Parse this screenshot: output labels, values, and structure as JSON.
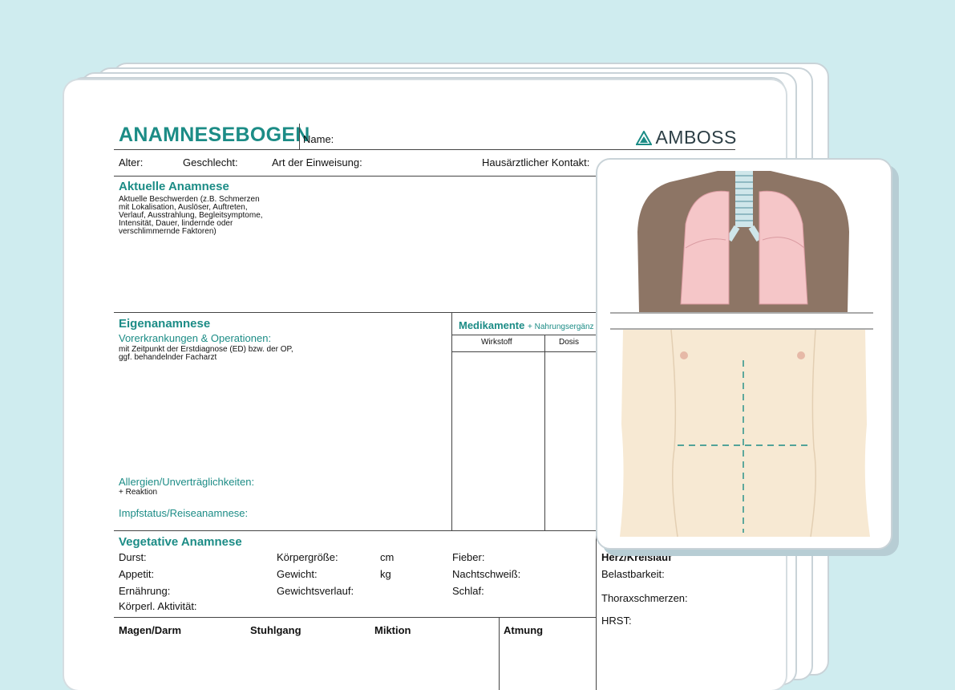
{
  "form": {
    "title": "ANAMNESEBOGEN",
    "name_label": "Name:",
    "logo_text": "AMBOSS",
    "row1": {
      "alter": "Alter:",
      "geschlecht": "Geschlecht:",
      "einweisung": "Art der Einweisung:",
      "hausarzt": "Hausärztlicher Kontakt:"
    },
    "aktuelle": {
      "heading": "Aktuelle Anamnese",
      "lines": [
        "Aktuelle Beschwerden (z.B. Schmerzen",
        "mit Lokalisation, Auslöser, Auftreten,",
        "Verlauf, Ausstrahlung, Begleitsymptome,",
        "Intensität, Dauer, lindernde oder",
        "verschlimmernde Faktoren)"
      ]
    },
    "eigen": {
      "heading": "Eigenanamnese",
      "subheading": "Vorerkrankungen & Operationen:",
      "lines": [
        "mit Zeitpunkt der Erstdiagnose (ED) bzw. der OP,",
        "ggf. behandelnder Facharzt"
      ],
      "allergien": "Allergien/Unverträglichkeiten:",
      "reaktion": "+ Reaktion",
      "impf": "Impfstatus/Reiseanamnese:"
    },
    "medikamente": {
      "heading": "Medikamente",
      "suffix": "+ Nahrungsergänz",
      "col_wirkstoff": "Wirkstoff",
      "col_dosis": "Dosis"
    },
    "vegetativ": {
      "heading": "Vegetative Anamnese",
      "col1": [
        "Durst:",
        "Appetit:",
        "Ernährung:",
        "Körperl. Aktivität:"
      ],
      "col2": [
        "Körpergröße:",
        "Gewicht:",
        "Gewichtsverlauf:"
      ],
      "units": [
        "cm",
        "kg"
      ],
      "col3": [
        "Fieber:",
        "Nachtschweiß:",
        "Schlaf:"
      ]
    },
    "herz": {
      "heading": "Herz/Kreislauf",
      "items": [
        "Belastbarkeit:",
        "Thoraxschmerzen:",
        "HRST:"
      ]
    },
    "bottom": {
      "magen": "Magen/Darm",
      "stuhlgang": "Stuhlgang",
      "miktion": "Miktion",
      "atmung": "Atmung"
    }
  },
  "colors": {
    "teal": "#1c8c86",
    "background": "#cfecef",
    "skin_dark": "#8d7565",
    "skin_light": "#f7e9d3",
    "lung": "#f5c6c8"
  }
}
